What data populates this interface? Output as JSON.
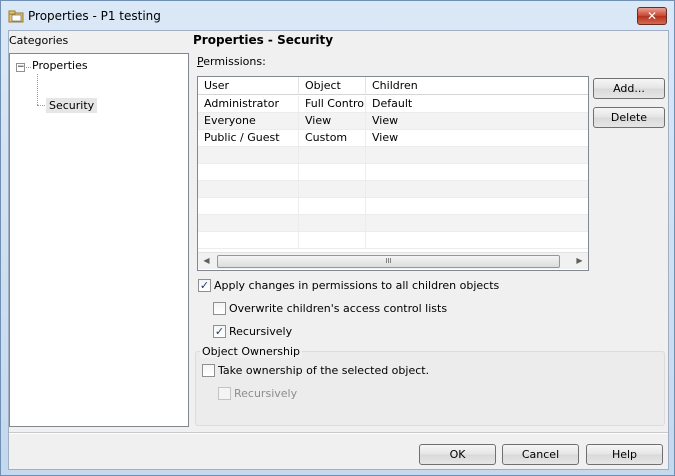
{
  "window": {
    "title": "Properties - P1 testing",
    "close_label": "✕"
  },
  "categories": {
    "label": "Categories",
    "tree": {
      "toggle": "−",
      "root": "Properties",
      "child": "Security"
    }
  },
  "panel": {
    "heading": "Properties - Security",
    "permissions_label_accel": "P",
    "permissions_label_rest": "ermissions:"
  },
  "permissions_table": {
    "columns": [
      "User",
      "Object",
      "Children"
    ],
    "rows": [
      {
        "user": "Administrator",
        "object": "Full Control",
        "children": "Default"
      },
      {
        "user": "Everyone",
        "object": "View",
        "children": "View"
      },
      {
        "user": "Public / Guest",
        "object": "Custom",
        "children": "View"
      }
    ],
    "scroll_left": "◀",
    "scroll_right": "▶",
    "scroll_grip": "III"
  },
  "buttons": {
    "add": "Add...",
    "delete": "Delete",
    "ok": "OK",
    "cancel": "Cancel",
    "help": "Help"
  },
  "options": {
    "apply_children": {
      "label": "Apply changes in permissions to all children objects",
      "checked": true,
      "mark": "✓"
    },
    "overwrite_acl": {
      "label": "Overwrite children's access control lists",
      "checked": false,
      "mark": ""
    },
    "recursively": {
      "label": "Recursively",
      "checked": true,
      "mark": "✓"
    }
  },
  "ownership": {
    "group_label": "Object Ownership",
    "take_ownership": {
      "label": "Take ownership of the selected object.",
      "checked": false,
      "mark": ""
    },
    "recursively": {
      "label": "Recursively",
      "checked": false,
      "enabled": false,
      "mark": ""
    }
  }
}
